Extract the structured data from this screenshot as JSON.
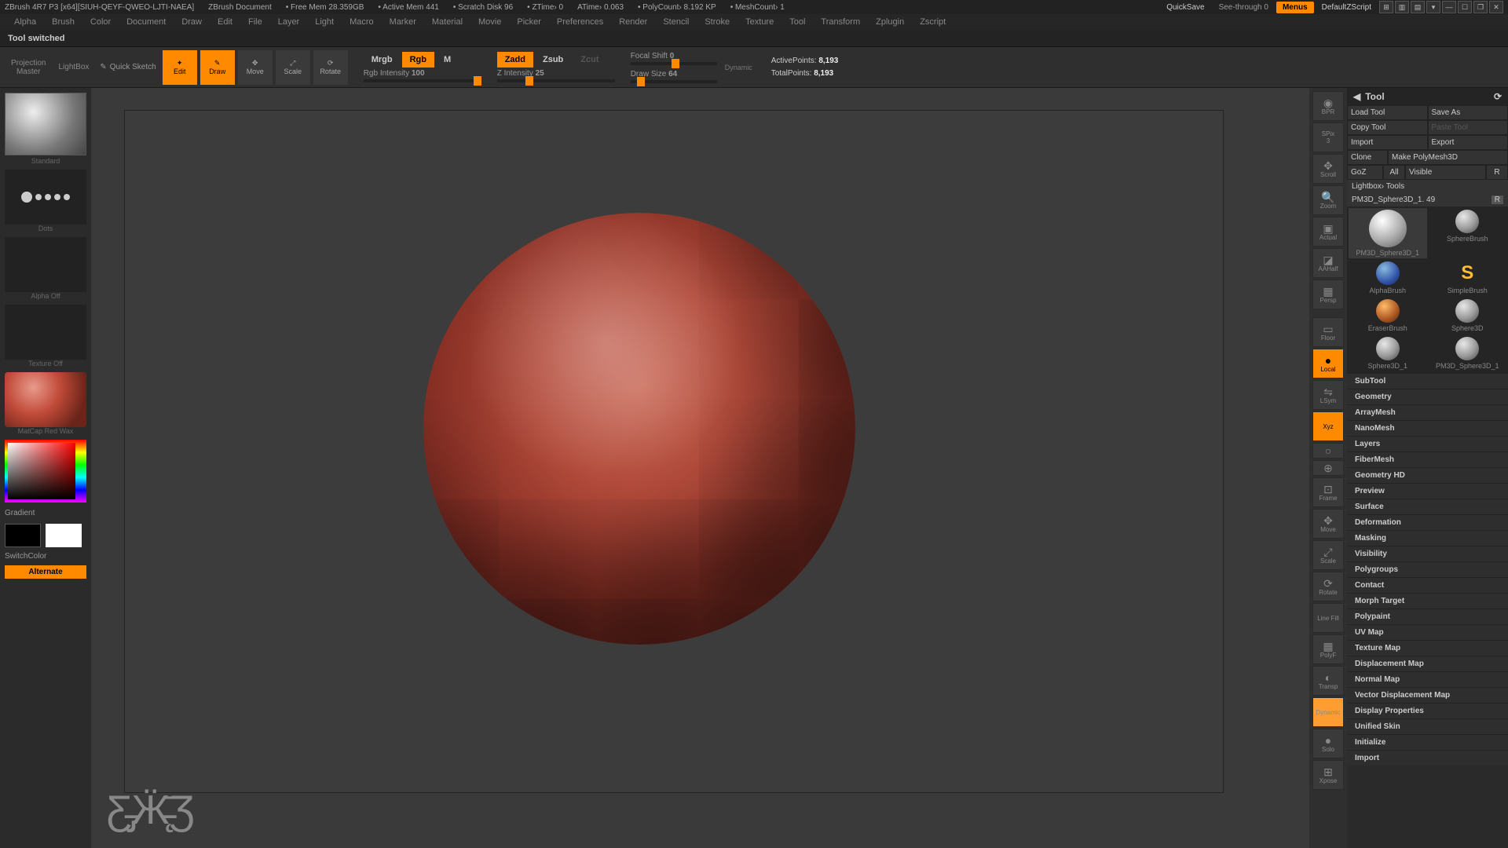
{
  "titlebar": {
    "app": "ZBrush 4R7 P3 [x64][SIUH-QEYF-QWEO-LJTI-NAEA]",
    "doc": "ZBrush Document",
    "mem": "Free Mem 28.359GB",
    "active_mem": "Active Mem 441",
    "scratch": "Scratch Disk 96",
    "ztime": "ZTime› 0",
    "atime": "ATime› 0.063",
    "polycount": "PolyCount› 8.192 KP",
    "meshcount": "MeshCount› 1",
    "quicksave": "QuickSave",
    "seethrough": "See-through  0",
    "menus": "Menus",
    "script": "DefaultZScript"
  },
  "menubar": [
    "Alpha",
    "Brush",
    "Color",
    "Document",
    "Draw",
    "Edit",
    "File",
    "Layer",
    "Light",
    "Macro",
    "Marker",
    "Material",
    "Movie",
    "Picker",
    "Preferences",
    "Render",
    "Stencil",
    "Stroke",
    "Texture",
    "Tool",
    "Transform",
    "Zplugin",
    "Zscript"
  ],
  "status": "Tool switched",
  "shelf": {
    "projection1": "Projection",
    "projection2": "Master",
    "lightbox": "LightBox",
    "quick_sketch": "Quick Sketch",
    "tools": [
      "Edit",
      "Draw",
      "Move",
      "Scale",
      "Rotate"
    ],
    "mrgb": "Mrgb",
    "rgb": "Rgb",
    "m": "M",
    "rgb_int_lab": "Rgb Intensity",
    "rgb_int_val": "100",
    "zadd": "Zadd",
    "zsub": "Zsub",
    "zcut": "Zcut",
    "zint_lab": "Z Intensity",
    "zint_val": "25",
    "focal_lab": "Focal Shift",
    "focal_val": "0",
    "draw_lab": "Draw Size",
    "draw_val": "64",
    "dynamic": "Dynamic",
    "active_lab": "ActivePoints:",
    "active_val": "8,193",
    "total_lab": "TotalPoints:",
    "total_val": "8,193"
  },
  "left": {
    "brush": "Standard",
    "stroke": "Dots",
    "alpha": "Alpha Off",
    "texture": "Texture Off",
    "material": "MatCap Red Wax",
    "gradient": "Gradient",
    "switchcolor": "SwitchColor",
    "alternate": "Alternate"
  },
  "toolstrip": {
    "bpr": "BPR",
    "spix_lab": "SPix",
    "spix_val": "3",
    "scroll": "Scroll",
    "zoom": "Zoom",
    "actual": "Actual",
    "aahalf": "AAHalf",
    "persp": "Persp",
    "floor": "Floor",
    "local": "Local",
    "lsym": "LSym",
    "xyz": "Xyz",
    "frame": "Frame",
    "move": "Move",
    "scale": "Scale",
    "rotate": "Rotate",
    "linefill": "Line Fill",
    "polyf": "PolyF",
    "transp": "Transp",
    "dynamic": "Dynamic",
    "solo": "Solo",
    "xpose": "Xpose"
  },
  "tool": {
    "title": "Tool",
    "load": "Load Tool",
    "saveas": "Save As",
    "copy": "Copy Tool",
    "paste": "Paste Tool",
    "import": "Import",
    "export": "Export",
    "clone": "Clone",
    "polymesh": "Make PolyMesh3D",
    "goz": "GoZ",
    "all": "All",
    "visible": "Visible",
    "r": "R",
    "lightbox": "Lightbox› Tools",
    "toolname": "PM3D_Sphere3D_1. 49",
    "rbtn": "R",
    "thumbs": [
      {
        "name": "PM3D_Sphere3D_1"
      },
      {
        "name": "SphereBrush"
      },
      {
        "name": ""
      },
      {
        "name": "AlphaBrush"
      },
      {
        "name": "SimpleBrush"
      },
      {
        "name": "EraserBrush"
      },
      {
        "name": "Sphere3D"
      },
      {
        "name": "Sphere3D_1"
      },
      {
        "name": "PM3D_Sphere3D_1"
      },
      {
        "name": ""
      }
    ],
    "sections": [
      "SubTool",
      "Geometry",
      "ArrayMesh",
      "NanoMesh",
      "Layers",
      "FiberMesh",
      "Geometry HD",
      "Preview",
      "Surface",
      "Deformation",
      "Masking",
      "Visibility",
      "Polygroups",
      "Contact",
      "Morph Target",
      "Polypaint",
      "UV Map",
      "Texture Map",
      "Displacement Map",
      "Normal Map",
      "Vector Displacement Map",
      "Display Properties",
      "Unified Skin",
      "Initialize",
      "Import"
    ]
  }
}
